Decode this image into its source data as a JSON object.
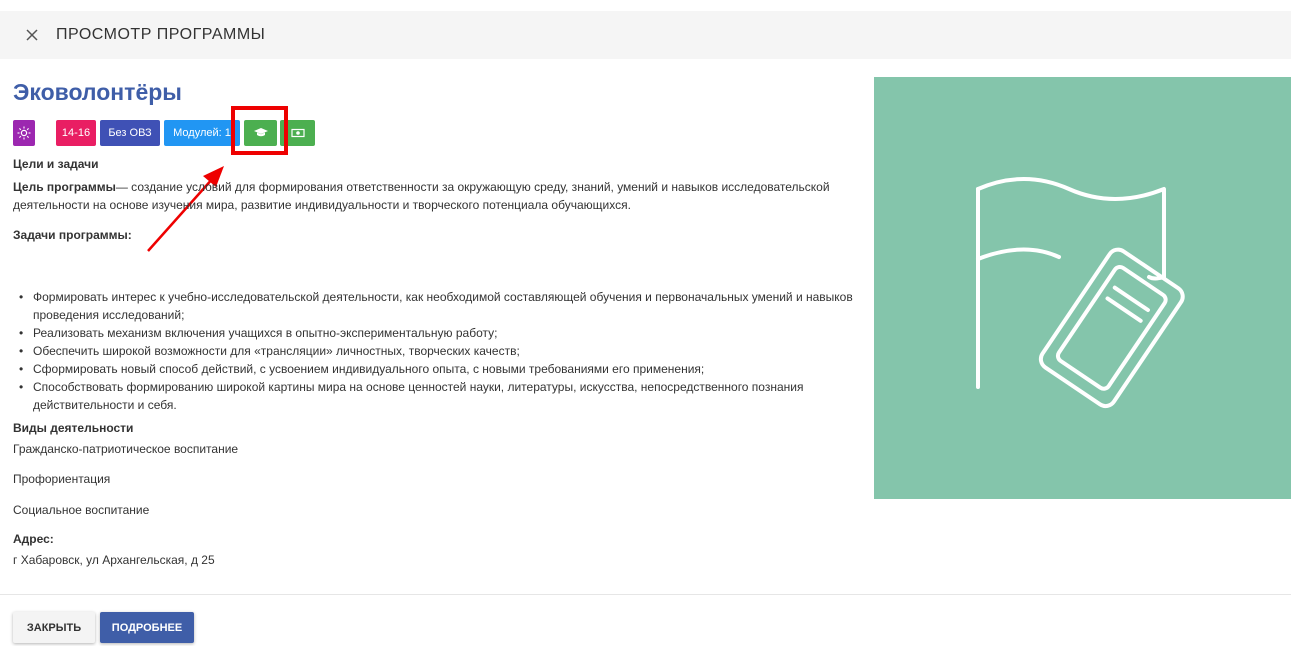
{
  "header": {
    "title": "ПРОСМОТР ПРОГРАММЫ",
    "close_icon": "close-icon"
  },
  "program": {
    "title": "Эковолонтёры",
    "chips": [
      {
        "name": "direction-icon-chip",
        "label": "",
        "icon": "sun-icon",
        "color": "#9c27b0"
      },
      {
        "name": "age-chip",
        "label": "14-16",
        "color": "#e91e63"
      },
      {
        "name": "ovz-chip",
        "label": "Без ОВЗ",
        "color": "#3f51b5"
      },
      {
        "name": "modules-chip",
        "label": "Модулей: 1",
        "color": "#2196f3"
      },
      {
        "name": "education-chip",
        "label": "",
        "icon": "graduation-cap-icon",
        "color": "#4caf50"
      },
      {
        "name": "payment-chip",
        "label": "",
        "icon": "money-icon",
        "color": "#4caf50"
      }
    ]
  },
  "goals": {
    "heading": "Цели и задачи",
    "goal_label": "Цель программы",
    "goal_text_line1": "— создание условий для формирования ответственности за окружающую среду, знаний, умений и навыков исследовательской",
    "goal_text_line2": "деятельности на основе изучения мира, развитие индивидуальности и творческого потенциала обучающихся.",
    "tasks_label": "Задачи программы:",
    "tasks": [
      "Формировать интерес к учебно-исследовательской деятельности, как необходимой составляющей обучения и первоначальных умений и навыков проведения исследований;",
      "Реализовать механизм включения учащихся в опытно-экспериментальную работу;",
      "Обеспечить широкой возможности для «трансляции» личностных, творческих качеств;",
      "Сформировать новый способ действий, с усвоением индивидуального опыта, с новыми требованиями его применения;",
      "Способствовать формированию широкой картины мира на основе ценностей науки, литературы, искусства, непосредственного познания действительности и себя."
    ]
  },
  "activities": {
    "heading": "Виды деятельности",
    "items": [
      "Гражданско-патриотическое воспитание",
      "Профориентация",
      "Социальное воспитание"
    ]
  },
  "address": {
    "heading": "Адрес:",
    "value": "г Хабаровск, ул Архангельская, д 25"
  },
  "image": {
    "icon": "flag-book-icon",
    "background": "#84c5ab"
  },
  "footer": {
    "close_label": "ЗАКРЫТЬ",
    "more_label": "ПОДРОБНЕЕ"
  },
  "annotation": {
    "highlight_color": "#ee0000"
  }
}
